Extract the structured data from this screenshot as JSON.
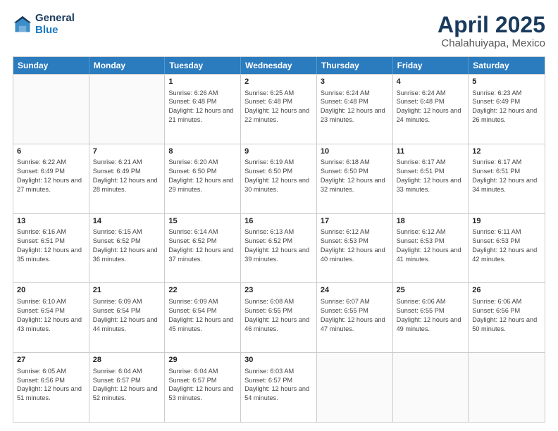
{
  "header": {
    "logo_line1": "General",
    "logo_line2": "Blue",
    "title": "April 2025",
    "subtitle": "Chalahuiyapa, Mexico"
  },
  "days_of_week": [
    "Sunday",
    "Monday",
    "Tuesday",
    "Wednesday",
    "Thursday",
    "Friday",
    "Saturday"
  ],
  "weeks": [
    [
      {
        "day": "",
        "sunrise": "",
        "sunset": "",
        "daylight": ""
      },
      {
        "day": "",
        "sunrise": "",
        "sunset": "",
        "daylight": ""
      },
      {
        "day": "1",
        "sunrise": "Sunrise: 6:26 AM",
        "sunset": "Sunset: 6:48 PM",
        "daylight": "Daylight: 12 hours and 21 minutes."
      },
      {
        "day": "2",
        "sunrise": "Sunrise: 6:25 AM",
        "sunset": "Sunset: 6:48 PM",
        "daylight": "Daylight: 12 hours and 22 minutes."
      },
      {
        "day": "3",
        "sunrise": "Sunrise: 6:24 AM",
        "sunset": "Sunset: 6:48 PM",
        "daylight": "Daylight: 12 hours and 23 minutes."
      },
      {
        "day": "4",
        "sunrise": "Sunrise: 6:24 AM",
        "sunset": "Sunset: 6:48 PM",
        "daylight": "Daylight: 12 hours and 24 minutes."
      },
      {
        "day": "5",
        "sunrise": "Sunrise: 6:23 AM",
        "sunset": "Sunset: 6:49 PM",
        "daylight": "Daylight: 12 hours and 26 minutes."
      }
    ],
    [
      {
        "day": "6",
        "sunrise": "Sunrise: 6:22 AM",
        "sunset": "Sunset: 6:49 PM",
        "daylight": "Daylight: 12 hours and 27 minutes."
      },
      {
        "day": "7",
        "sunrise": "Sunrise: 6:21 AM",
        "sunset": "Sunset: 6:49 PM",
        "daylight": "Daylight: 12 hours and 28 minutes."
      },
      {
        "day": "8",
        "sunrise": "Sunrise: 6:20 AM",
        "sunset": "Sunset: 6:50 PM",
        "daylight": "Daylight: 12 hours and 29 minutes."
      },
      {
        "day": "9",
        "sunrise": "Sunrise: 6:19 AM",
        "sunset": "Sunset: 6:50 PM",
        "daylight": "Daylight: 12 hours and 30 minutes."
      },
      {
        "day": "10",
        "sunrise": "Sunrise: 6:18 AM",
        "sunset": "Sunset: 6:50 PM",
        "daylight": "Daylight: 12 hours and 32 minutes."
      },
      {
        "day": "11",
        "sunrise": "Sunrise: 6:17 AM",
        "sunset": "Sunset: 6:51 PM",
        "daylight": "Daylight: 12 hours and 33 minutes."
      },
      {
        "day": "12",
        "sunrise": "Sunrise: 6:17 AM",
        "sunset": "Sunset: 6:51 PM",
        "daylight": "Daylight: 12 hours and 34 minutes."
      }
    ],
    [
      {
        "day": "13",
        "sunrise": "Sunrise: 6:16 AM",
        "sunset": "Sunset: 6:51 PM",
        "daylight": "Daylight: 12 hours and 35 minutes."
      },
      {
        "day": "14",
        "sunrise": "Sunrise: 6:15 AM",
        "sunset": "Sunset: 6:52 PM",
        "daylight": "Daylight: 12 hours and 36 minutes."
      },
      {
        "day": "15",
        "sunrise": "Sunrise: 6:14 AM",
        "sunset": "Sunset: 6:52 PM",
        "daylight": "Daylight: 12 hours and 37 minutes."
      },
      {
        "day": "16",
        "sunrise": "Sunrise: 6:13 AM",
        "sunset": "Sunset: 6:52 PM",
        "daylight": "Daylight: 12 hours and 39 minutes."
      },
      {
        "day": "17",
        "sunrise": "Sunrise: 6:12 AM",
        "sunset": "Sunset: 6:53 PM",
        "daylight": "Daylight: 12 hours and 40 minutes."
      },
      {
        "day": "18",
        "sunrise": "Sunrise: 6:12 AM",
        "sunset": "Sunset: 6:53 PM",
        "daylight": "Daylight: 12 hours and 41 minutes."
      },
      {
        "day": "19",
        "sunrise": "Sunrise: 6:11 AM",
        "sunset": "Sunset: 6:53 PM",
        "daylight": "Daylight: 12 hours and 42 minutes."
      }
    ],
    [
      {
        "day": "20",
        "sunrise": "Sunrise: 6:10 AM",
        "sunset": "Sunset: 6:54 PM",
        "daylight": "Daylight: 12 hours and 43 minutes."
      },
      {
        "day": "21",
        "sunrise": "Sunrise: 6:09 AM",
        "sunset": "Sunset: 6:54 PM",
        "daylight": "Daylight: 12 hours and 44 minutes."
      },
      {
        "day": "22",
        "sunrise": "Sunrise: 6:09 AM",
        "sunset": "Sunset: 6:54 PM",
        "daylight": "Daylight: 12 hours and 45 minutes."
      },
      {
        "day": "23",
        "sunrise": "Sunrise: 6:08 AM",
        "sunset": "Sunset: 6:55 PM",
        "daylight": "Daylight: 12 hours and 46 minutes."
      },
      {
        "day": "24",
        "sunrise": "Sunrise: 6:07 AM",
        "sunset": "Sunset: 6:55 PM",
        "daylight": "Daylight: 12 hours and 47 minutes."
      },
      {
        "day": "25",
        "sunrise": "Sunrise: 6:06 AM",
        "sunset": "Sunset: 6:55 PM",
        "daylight": "Daylight: 12 hours and 49 minutes."
      },
      {
        "day": "26",
        "sunrise": "Sunrise: 6:06 AM",
        "sunset": "Sunset: 6:56 PM",
        "daylight": "Daylight: 12 hours and 50 minutes."
      }
    ],
    [
      {
        "day": "27",
        "sunrise": "Sunrise: 6:05 AM",
        "sunset": "Sunset: 6:56 PM",
        "daylight": "Daylight: 12 hours and 51 minutes."
      },
      {
        "day": "28",
        "sunrise": "Sunrise: 6:04 AM",
        "sunset": "Sunset: 6:57 PM",
        "daylight": "Daylight: 12 hours and 52 minutes."
      },
      {
        "day": "29",
        "sunrise": "Sunrise: 6:04 AM",
        "sunset": "Sunset: 6:57 PM",
        "daylight": "Daylight: 12 hours and 53 minutes."
      },
      {
        "day": "30",
        "sunrise": "Sunrise: 6:03 AM",
        "sunset": "Sunset: 6:57 PM",
        "daylight": "Daylight: 12 hours and 54 minutes."
      },
      {
        "day": "",
        "sunrise": "",
        "sunset": "",
        "daylight": ""
      },
      {
        "day": "",
        "sunrise": "",
        "sunset": "",
        "daylight": ""
      },
      {
        "day": "",
        "sunrise": "",
        "sunset": "",
        "daylight": ""
      }
    ]
  ]
}
